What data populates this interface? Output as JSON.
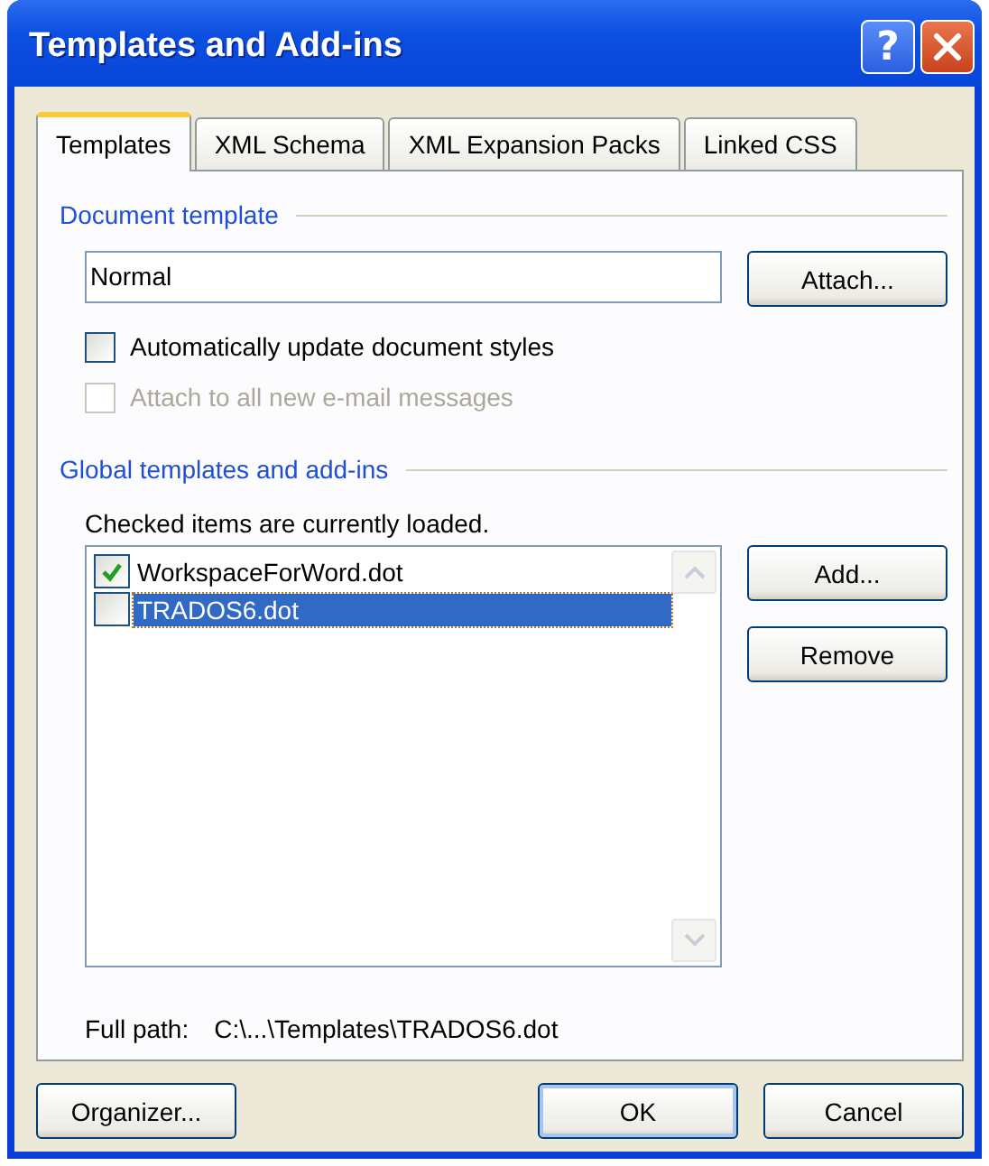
{
  "window": {
    "title": "Templates and Add-ins",
    "help_label": "?"
  },
  "tabs": [
    {
      "label": "Templates",
      "selected": true
    },
    {
      "label": "XML Schema",
      "selected": false
    },
    {
      "label": "XML Expansion Packs",
      "selected": false
    },
    {
      "label": "Linked CSS",
      "selected": false
    }
  ],
  "document_template": {
    "heading": "Document template",
    "value": "Normal",
    "attach_button": "Attach...",
    "options": [
      {
        "label": "Automatically update document styles",
        "checked": false,
        "disabled": false
      },
      {
        "label": "Attach to all new e-mail messages",
        "checked": false,
        "disabled": true
      }
    ]
  },
  "global_templates": {
    "heading": "Global templates and add-ins",
    "note": "Checked items are currently loaded.",
    "items": [
      {
        "label": "WorkspaceForWord.dot",
        "checked": true,
        "selected": false
      },
      {
        "label": "TRADOS6.dot",
        "checked": false,
        "selected": true
      }
    ],
    "buttons": [
      "Add...",
      "Remove"
    ],
    "full_path_label": "Full path:",
    "full_path": "C:\\...\\Templates\\TRADOS6.dot"
  },
  "buttons": [
    {
      "label": "Organizer...",
      "default": false
    },
    {
      "label": "OK",
      "default": true
    },
    {
      "label": "Cancel",
      "default": false
    }
  ]
}
